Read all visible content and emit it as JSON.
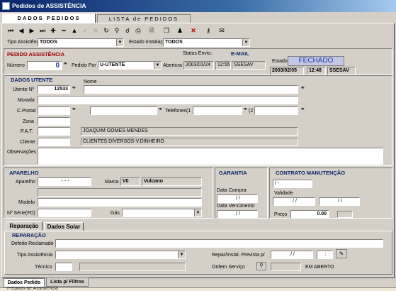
{
  "window": {
    "title": "Pedidos de ASSISTÊNCIA"
  },
  "tabs": [
    "DADOS PEDIDOS",
    "LISTA de PEDIDOS"
  ],
  "toolbar": {
    "icons": [
      "first-icon",
      "prev-icon",
      "next-icon",
      "last-icon",
      "add-icon",
      "delete-icon",
      "up-icon",
      "confirm-icon",
      "cancel-icon",
      "refresh-icon",
      "find-icon",
      "search-icon",
      "print-icon",
      "preview-icon",
      "copy-icon",
      "users-icon",
      "close-icon",
      "key-icon",
      "mail-icon"
    ]
  },
  "filters": {
    "tipo_label": "Tipo Assistência",
    "tipo_value": "TODOS",
    "estado_label": "Estado Instalação",
    "estado_value": "TODOS"
  },
  "pedido": {
    "section": "PEDIDO ASSISTÊNCIA",
    "numero_label": "Número",
    "numero_value": "0",
    "pedido_por_label": "Pedido Por",
    "pedido_por_value": "U-UTENTE",
    "abertura_label": "Abertura",
    "status_envio_label": "Status Envio:",
    "email_label": "E-MAIL",
    "abertura_date": "2003/01/24",
    "abertura_time": "12:55",
    "abertura_user": "SSESAV",
    "estado_label": "Estado",
    "estado_value": "FECHADO",
    "estado_date": "2003/02/05",
    "estado_time": "12:48",
    "estado_user": "SSESAV"
  },
  "utente": {
    "section": "DADOS UTENTE",
    "nome_label": "Nome",
    "utente_label": "Utente Nº",
    "utente_value": "12533",
    "morada_label": "Morada",
    "cpostal_label": "C.Postal",
    "telefones_label": "Telefones(1",
    "tel2_label": "(2",
    "zona_label": "Zona",
    "pat_label": "P.A.T.",
    "pat_value": "JOAQUIM GOMES MENDES",
    "cliente_label": "Cliente",
    "cliente_value": "CLIENTES DIVERSOS-V.DINHEIRO",
    "obs_label": "Observações"
  },
  "aparelho": {
    "section": "APARELHO",
    "aparelho_label": "Aparelho",
    "aparelho_value": "-  -  -",
    "marca_label": "Marca",
    "marca_code": "V0",
    "marca_value": "Vulcano",
    "modelo_label": "Modelo",
    "serie_label": "Nº Série(FD)",
    "gas_label": "Gás"
  },
  "garantia": {
    "section": "GARANTIA",
    "data_compra_label": "Data Compra",
    "data_compra_value": "/  /",
    "data_venc_label": "Data Vencimento",
    "data_venc_value": "/  /"
  },
  "contrato": {
    "section": "CONTRATO MANUTENÇÃO",
    "field1": "/  -",
    "validade_label": "Validade",
    "validade_from": "/  /",
    "validade_to": "/  /",
    "preco_label": "Preço",
    "preco_value": "0.00"
  },
  "subtabs": [
    "Reparação",
    "Dados Solar"
  ],
  "reparacao": {
    "section": "REPARAÇÃO",
    "defeito_label": "Defeito Reclamado",
    "tipo_label": "Tipo Assistência",
    "tecnico_label": "Técnico",
    "prevista_label": "Repar/Instal. Prevista p/",
    "prevista_date": "/  /",
    "prevista_time": ":",
    "ordem_label": "Ordem Serviço",
    "ordem_status": "EM ABERTO"
  },
  "bottom_tabs": [
    "Dados Pedido",
    "Lista p/ Filtros"
  ],
  "taskbar": {
    "text": "Pedidos de Assistência"
  }
}
